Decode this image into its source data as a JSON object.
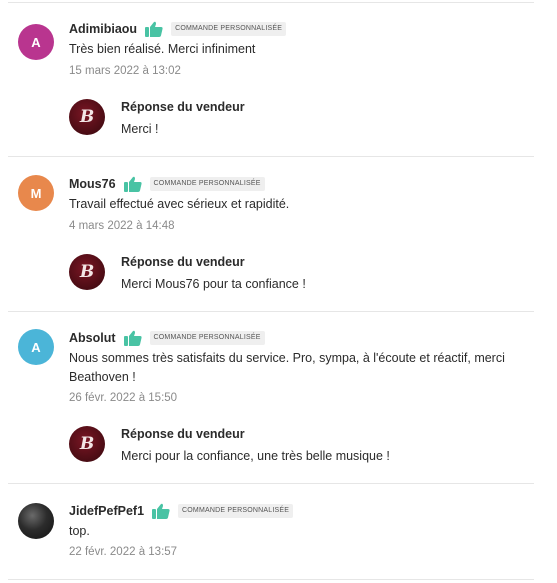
{
  "colors": {
    "thumb_icon": "#49c3a4",
    "divider": "#e6e6e6",
    "reply_logo": "#5a0f1a"
  },
  "reviews": [
    {
      "avatar_letter": "A",
      "avatar_color": "#b9358f",
      "author": "Adimibiaou",
      "badge": "COMMANDE PERSONNALISÉE",
      "text": "Très bien réalisé. Merci infiniment",
      "date": "15 mars 2022 à 13:02",
      "reply_title": "Réponse du vendeur",
      "reply_text": "Merci !"
    },
    {
      "avatar_letter": "M",
      "avatar_color": "#e8884c",
      "author": "Mous76",
      "badge": "COMMANDE PERSONNALISÉE",
      "text": "Travail effectué avec sérieux et rapidité.",
      "date": "4 mars 2022 à 14:48",
      "reply_title": "Réponse du vendeur",
      "reply_text": "Merci Mous76 pour ta confiance !"
    },
    {
      "avatar_letter": "A",
      "avatar_color": "#4bb5d8",
      "author": "Absolut",
      "badge": "COMMANDE PERSONNALISÉE",
      "text_line1": "Nous sommes très satisfaits du service. Pro, sympa, à l'écoute et réactif, merci",
      "text_line2": "Beathoven !",
      "date": "26 févr. 2022 à 15:50",
      "reply_title": "Réponse du vendeur",
      "reply_text": "Merci pour la confiance, une très belle musique !"
    },
    {
      "avatar_letter": "",
      "author": "JidefPefPef1",
      "badge": "COMMANDE PERSONNALISÉE",
      "text": "top.",
      "date": "22 févr. 2022 à 13:57"
    }
  ],
  "reply_logo_glyph": "B"
}
